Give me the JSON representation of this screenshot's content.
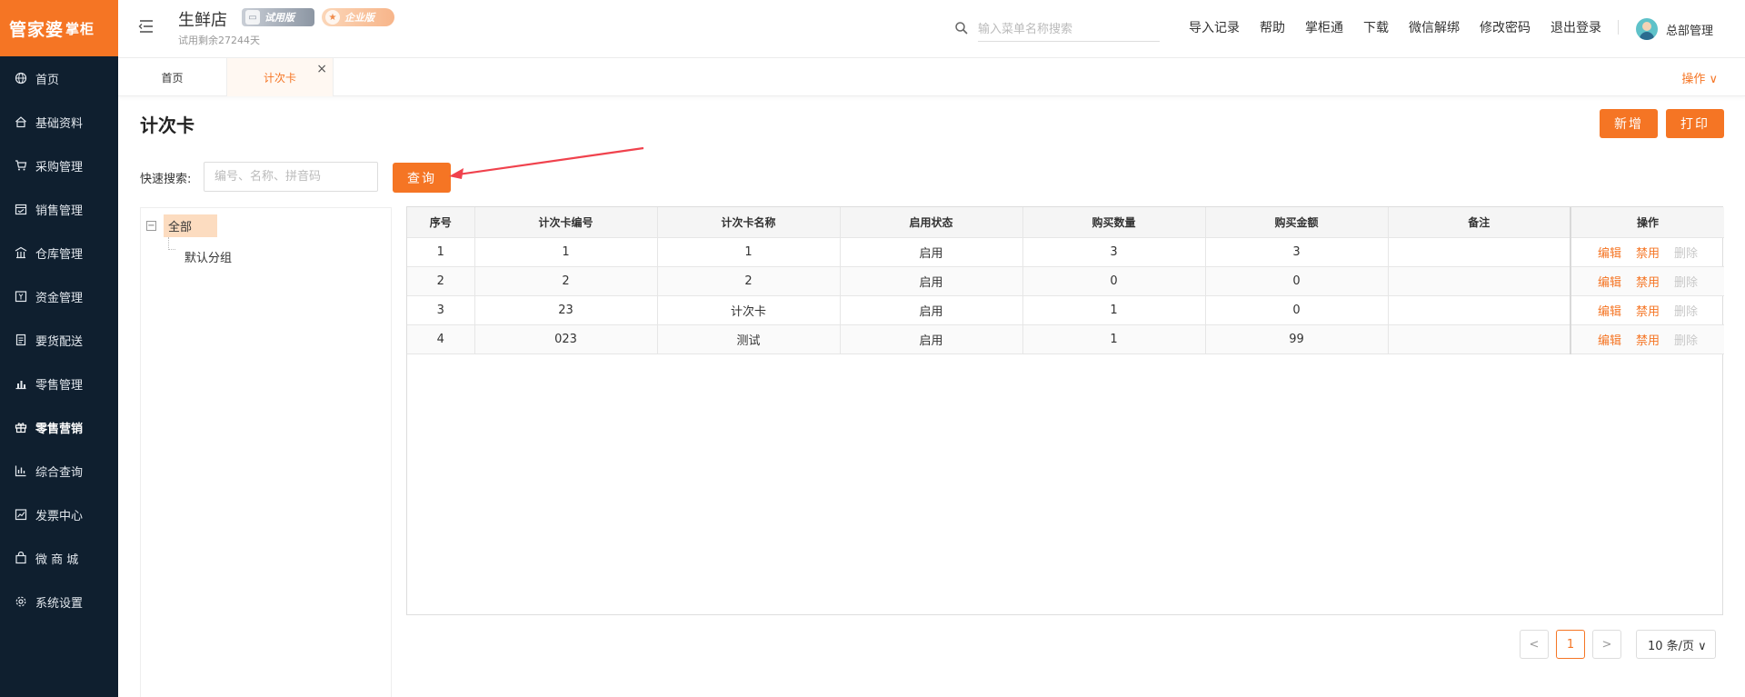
{
  "brand": {
    "logo_main": "管家婆",
    "logo_sub": "掌柜",
    "accent": "#f57524",
    "sidebar_bg": "#0f1f2f"
  },
  "sidebar": {
    "items": [
      {
        "label": "首页",
        "icon": "globe-icon"
      },
      {
        "label": "基础资料",
        "icon": "home-icon"
      },
      {
        "label": "采购管理",
        "icon": "cart-icon"
      },
      {
        "label": "销售管理",
        "icon": "calendar-icon"
      },
      {
        "label": "仓库管理",
        "icon": "warehouse-icon"
      },
      {
        "label": "资金管理",
        "icon": "money-icon"
      },
      {
        "label": "要货配送",
        "icon": "document-icon"
      },
      {
        "label": "零售管理",
        "icon": "bar-chart-icon"
      },
      {
        "label": "零售营销",
        "icon": "gift-icon"
      },
      {
        "label": "综合查询",
        "icon": "chart-icon"
      },
      {
        "label": "发票中心",
        "icon": "trend-icon"
      },
      {
        "label": "微 商 城",
        "icon": "bag-icon"
      },
      {
        "label": "系统设置",
        "icon": "gear-icon"
      }
    ],
    "active_index": 8
  },
  "header": {
    "store_name": "生鲜店",
    "badge_trial": "试用版",
    "badge_enterprise": "企业版",
    "trial_remaining": "试用剩余27244天",
    "search_placeholder": "输入菜单名称搜索",
    "links": [
      "导入记录",
      "帮助",
      "掌柜通",
      "下载",
      "微信解绑",
      "修改密码",
      "退出登录"
    ],
    "user_name": "总部管理"
  },
  "tabs": {
    "home": "首页",
    "current": "计次卡",
    "close": "×",
    "ops": "操作 ∨"
  },
  "page": {
    "title": "计次卡",
    "add_button": "新增",
    "print_button": "打印",
    "quick_search_label": "快速搜索:",
    "quick_search_placeholder": "编号、名称、拼音码",
    "query_button": "查询"
  },
  "tree": {
    "root": "全部",
    "toggle": "−",
    "children": [
      "默认分组"
    ]
  },
  "table": {
    "columns": [
      "序号",
      "计次卡编号",
      "计次卡名称",
      "启用状态",
      "购买数量",
      "购买金额",
      "备注",
      "操作"
    ],
    "rows": [
      [
        "1",
        "1",
        "1",
        "启用",
        "3",
        "3",
        ""
      ],
      [
        "2",
        "2",
        "2",
        "启用",
        "0",
        "0",
        ""
      ],
      [
        "3",
        "23",
        "计次卡",
        "启用",
        "1",
        "0",
        ""
      ],
      [
        "4",
        "023",
        "测试",
        "启用",
        "1",
        "99",
        ""
      ]
    ],
    "actions": [
      "编辑",
      "禁用",
      "删除"
    ]
  },
  "pagination": {
    "prev": "<",
    "current": "1",
    "next": ">",
    "page_size": "10 条/页 ∨"
  }
}
